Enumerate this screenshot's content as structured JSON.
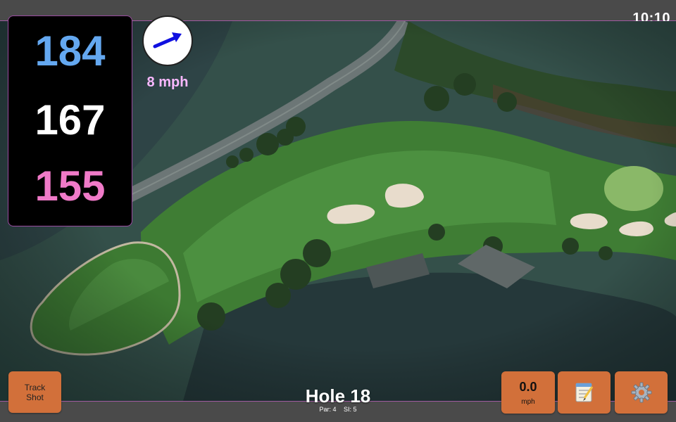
{
  "status_bar": {
    "time": "10:10"
  },
  "distances": {
    "back": "184",
    "middle": "167",
    "front": "155"
  },
  "wind": {
    "speed_label": "8 mph",
    "arrow_color": "#1010e0",
    "icon": "wind-direction-arrow"
  },
  "hole": {
    "title": "Hole 18",
    "par_label": "Par: 4",
    "si_label": "SI: 5"
  },
  "buttons": {
    "track_shot_line1": "Track",
    "track_shot_line2": "Shot",
    "speed_value": "0.0",
    "speed_unit": "mph",
    "notes_icon": "notepad-icon",
    "settings_icon": "gear-icon"
  },
  "colors": {
    "back_distance": "#64a8f0",
    "middle_distance": "#ffffff",
    "front_distance": "#f07ac8",
    "button": "#d2703a",
    "accent_border": "#a05aa0"
  }
}
